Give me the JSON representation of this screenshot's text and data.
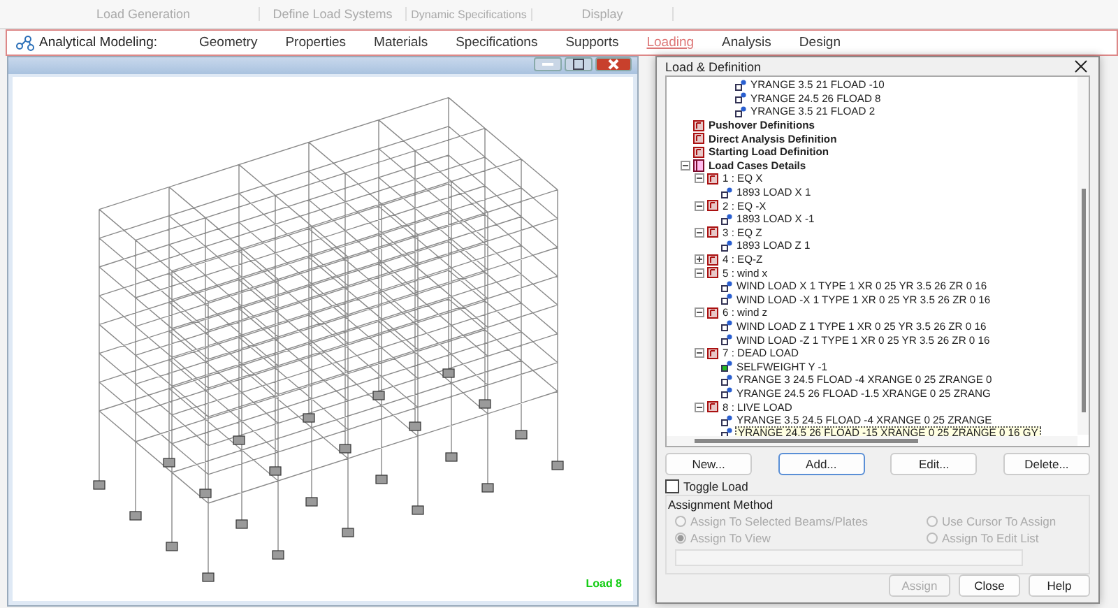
{
  "ribbon_groups": [
    "Load Generation",
    "Define Load Systems",
    "Dynamic Specifications",
    "Display"
  ],
  "tab_bar": {
    "label": "Analytical Modeling:",
    "tabs": [
      {
        "label": "Geometry",
        "selected": false
      },
      {
        "label": "Properties",
        "selected": false
      },
      {
        "label": "Materials",
        "selected": false
      },
      {
        "label": "Specifications",
        "selected": false
      },
      {
        "label": "Supports",
        "selected": false
      },
      {
        "label": "Loading",
        "selected": true
      },
      {
        "label": "Analysis",
        "selected": false
      },
      {
        "label": "Design",
        "selected": false
      }
    ]
  },
  "viewport": {
    "status_label": "Load 8"
  },
  "dialog": {
    "title": "Load & Definition",
    "partial_branch": [
      {
        "label": "YRANGE 3.5 21 FLOAD -10",
        "kind": "load",
        "selected": false
      },
      {
        "label": "YRANGE 24.5 26 FLOAD 8",
        "kind": "load",
        "selected": false
      },
      {
        "label": "YRANGE 3.5 21 FLOAD 2",
        "kind": "load",
        "selected": false
      }
    ],
    "tree": [
      {
        "label": "Pushover Definitions",
        "kind": "definition",
        "selected": false
      },
      {
        "label": "Direct Analysis Definition",
        "kind": "definition",
        "selected": false
      },
      {
        "label": "Starting Load Definition",
        "kind": "definition",
        "selected": false
      },
      {
        "label": "Load Cases Details",
        "kind": "root",
        "expanded": true,
        "selected": false,
        "children": [
          {
            "label": "1 : EQ X",
            "kind": "case",
            "expanded": true,
            "selected": false,
            "children": [
              {
                "label": "1893 LOAD X 1",
                "kind": "load",
                "selected": false
              }
            ]
          },
          {
            "label": "2 : EQ -X",
            "kind": "case",
            "expanded": true,
            "selected": false,
            "children": [
              {
                "label": "1893 LOAD X -1",
                "kind": "load",
                "selected": false
              }
            ]
          },
          {
            "label": "3 : EQ Z",
            "kind": "case",
            "expanded": true,
            "selected": false,
            "children": [
              {
                "label": "1893 LOAD Z 1",
                "kind": "load",
                "selected": false
              }
            ]
          },
          {
            "label": "4 : EQ-Z",
            "kind": "case",
            "expanded": false,
            "selected": false
          },
          {
            "label": "5 : wind x",
            "kind": "case",
            "expanded": true,
            "selected": false,
            "children": [
              {
                "label": "WIND LOAD X 1 TYPE 1 XR 0 25 YR 3.5 26 ZR 0 16",
                "kind": "load",
                "selected": false
              },
              {
                "label": "WIND LOAD -X 1 TYPE 1 XR 0 25 YR 3.5 26 ZR 0 16",
                "kind": "load",
                "selected": false
              }
            ]
          },
          {
            "label": "6 : wind z",
            "kind": "case",
            "expanded": true,
            "selected": false,
            "children": [
              {
                "label": "WIND LOAD Z 1 TYPE 1 XR 0 25 YR 3.5 26 ZR 0 16",
                "kind": "load",
                "selected": false
              },
              {
                "label": "WIND LOAD -Z 1 TYPE 1 XR 0 25 YR 3.5 26 ZR 0 16",
                "kind": "load",
                "selected": false
              }
            ]
          },
          {
            "label": "7 : DEAD LOAD",
            "kind": "case",
            "expanded": true,
            "selected": false,
            "children": [
              {
                "label": "SELFWEIGHT Y -1",
                "kind": "selfweight",
                "selected": false
              },
              {
                "label": "YRANGE 3 24.5 FLOAD -4 XRANGE 0 25  ZRANGE 0",
                "kind": "load",
                "selected": false
              },
              {
                "label": "YRANGE 24.5 26 FLOAD -1.5 XRANGE 0 25  ZRANG",
                "kind": "load",
                "selected": false
              }
            ]
          },
          {
            "label": "8 : LIVE LOAD",
            "kind": "case",
            "expanded": true,
            "selected": false,
            "children": [
              {
                "label": "YRANGE 3.5 24.5 FLOAD -4 XRANGE 0 25  ZRANGE",
                "kind": "load",
                "selected": false
              },
              {
                "label": "YRANGE 24.5 26 FLOAD -15 XRANGE 0 25  ZRANGE 0 16  GY",
                "kind": "load",
                "selected": true
              }
            ]
          }
        ]
      }
    ],
    "action_buttons": [
      "New...",
      "Add...",
      "Edit...",
      "Delete..."
    ],
    "toggle_load": {
      "label": "Toggle Load",
      "checked": false
    },
    "assignment_method": {
      "title": "Assignment Method",
      "options": [
        {
          "label": "Assign To Selected Beams/Plates",
          "selected": false,
          "disabled": true
        },
        {
          "label": "Use Cursor To Assign",
          "selected": false,
          "disabled": true
        },
        {
          "label": "Assign To View",
          "selected": true,
          "disabled": true
        },
        {
          "label": "Assign To Edit List",
          "selected": false,
          "disabled": true
        }
      ]
    },
    "footer_buttons": [
      {
        "label": "Assign",
        "disabled": true
      },
      {
        "label": "Close",
        "disabled": false
      },
      {
        "label": "Help",
        "disabled": false
      }
    ]
  }
}
